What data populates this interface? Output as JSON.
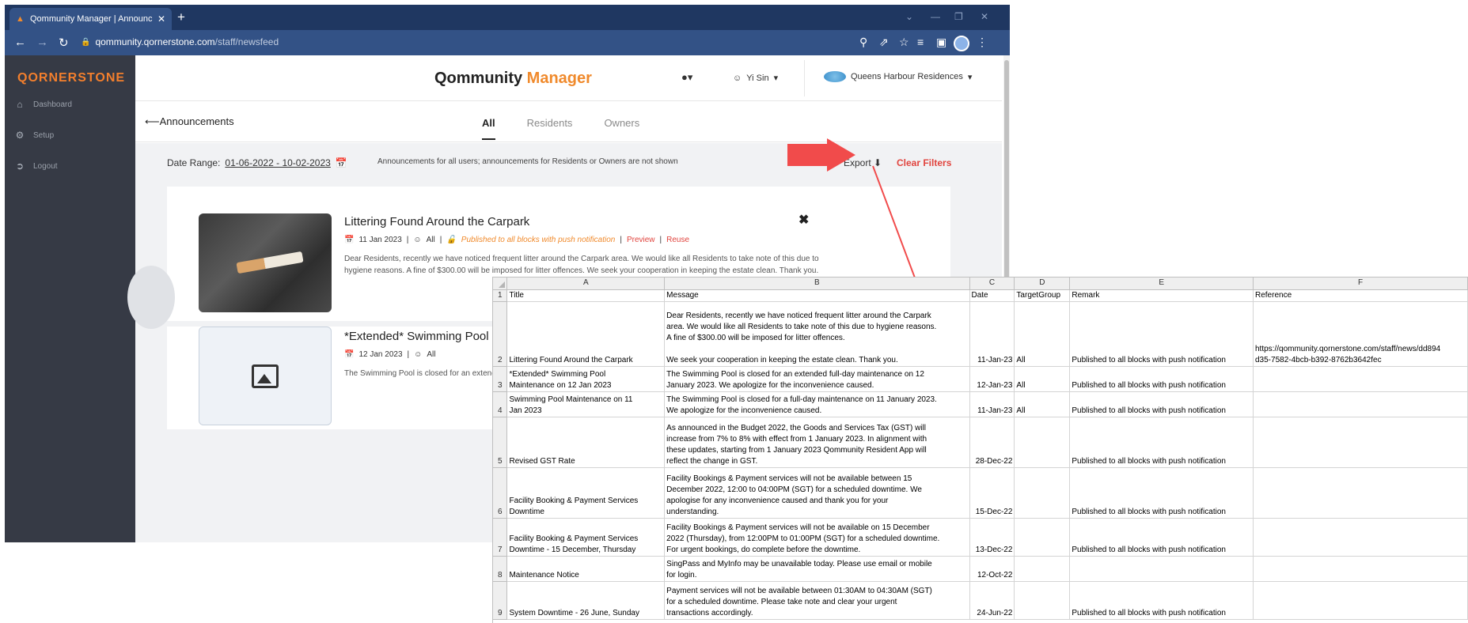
{
  "browser": {
    "tab_title": "Qommunity Manager | Announce",
    "url_host": "qommunity.qornerstone.com",
    "url_path": "/staff/newsfeed"
  },
  "sidebar": {
    "logo": "QORNERSTONE",
    "items": [
      {
        "label": "Dashboard",
        "icon": "home-icon"
      },
      {
        "label": "Setup",
        "icon": "gear-icon"
      },
      {
        "label": "Logout",
        "icon": "logout-icon"
      }
    ]
  },
  "header": {
    "brand_main": "Qommunity ",
    "brand_accent": "Manager",
    "user": "Yi Sin",
    "property": "Queens Harbour Residences"
  },
  "subheader": {
    "back_label": "Announcements",
    "tabs": [
      {
        "label": "All",
        "active": true
      },
      {
        "label": "Residents",
        "active": false
      },
      {
        "label": "Owners",
        "active": false
      }
    ]
  },
  "filters": {
    "date_range_label": "Date Range:",
    "date_range_value": "01-06-2022  -  10-02-2023",
    "note": "Announcements for all users; announcements for Residents or Owners are not shown",
    "export_label": "Export",
    "clear_label": "Clear Filters"
  },
  "cards": [
    {
      "title": "Littering Found Around the Carpark",
      "date": "11 Jan 2023",
      "audience": "All",
      "status": "Published to all blocks with push notification",
      "preview": "Preview",
      "reuse": "Reuse",
      "body": "Dear Residents, recently we have noticed frequent litter around the Carpark area. We would like all Residents to take note of this due to hygiene reasons. A fine of $300.00 will be imposed for litter offences. We seek your cooperation in keeping the estate clean. Thank you."
    },
    {
      "title": "*Extended* Swimming Pool Maintenance on 12 Jan 2023",
      "date": "12 Jan 2023",
      "audience": "All",
      "body": "The Swimming Pool is closed for an extended full-day maintenance on 12 January 2023. We apologize for the inconvenience caused."
    }
  ],
  "spreadsheet": {
    "columns": [
      "A",
      "B",
      "C",
      "D",
      "E",
      "F"
    ],
    "rows": [
      {
        "n": "1",
        "cells": [
          "Title",
          "Message",
          "Date",
          "TargetGroup",
          "Remark",
          "Reference"
        ]
      },
      {
        "n": "2",
        "cells": [
          "Littering Found Around the Carpark",
          "Dear Residents, recently we have noticed frequent litter around the Carpark\narea. We would like all Residents to take note of this due to hygiene reasons.\nA fine of $300.00 will be imposed for litter offences.\n\nWe seek your cooperation in keeping the estate clean. Thank you.",
          "11-Jan-23",
          "All",
          "Published to all blocks with push notification",
          "https://qommunity.qornerstone.com/staff/news/dd894\nd35-7582-4bcb-b392-8762b3642fec"
        ]
      },
      {
        "n": "3",
        "cells": [
          "*Extended* Swimming Pool\nMaintenance on 12 Jan 2023",
          "The Swimming Pool is closed for an extended full-day maintenance on 12\nJanuary 2023. We apologize for the inconvenience caused.",
          "12-Jan-23",
          "All",
          "Published to all blocks with push notification",
          ""
        ]
      },
      {
        "n": "4",
        "cells": [
          "Swimming Pool Maintenance on 11\nJan 2023",
          "The Swimming Pool is closed for a full-day maintenance on 11 January 2023.\nWe apologize for the inconvenience caused.",
          "11-Jan-23",
          "All",
          "Published to all blocks with push notification",
          ""
        ]
      },
      {
        "n": "5",
        "cells": [
          "Revised GST Rate",
          "As announced in the Budget 2022, the Goods and Services Tax (GST) will\nincrease from 7% to 8% with effect from 1 January 2023. In alignment with\nthese updates, starting from 1 January 2023 Qommunity Resident App will\nreflect the change in GST.",
          "28-Dec-22",
          "",
          "Published to all blocks with push notification",
          ""
        ]
      },
      {
        "n": "6",
        "cells": [
          "Facility Booking & Payment Services\nDowntime",
          "Facility Bookings & Payment services will not be available between 15\nDecember 2022, 12:00 to 04:00PM (SGT) for a scheduled downtime. We\napologise for any inconvenience caused and thank you for your\nunderstanding.",
          "15-Dec-22",
          "",
          "Published to all blocks with push notification",
          ""
        ]
      },
      {
        "n": "7",
        "cells": [
          "Facility Booking & Payment Services\nDowntime - 15 December, Thursday",
          "Facility Bookings & Payment services will not be available on 15 December\n2022 (Thursday), from 12:00PM to 01:00PM (SGT) for a scheduled downtime.\nFor urgent bookings, do complete before the downtime.",
          "13-Dec-22",
          "",
          "Published to all blocks with push notification",
          ""
        ]
      },
      {
        "n": "8",
        "cells": [
          "Maintenance Notice",
          "SingPass and MyInfo may be unavailable today. Please use email or mobile\nfor login.",
          "12-Oct-22",
          "",
          "",
          ""
        ]
      },
      {
        "n": "9",
        "cells": [
          "System Downtime - 26 June, Sunday",
          "Payment services will not be available between 01:30AM to 04:30AM (SGT)\nfor a scheduled downtime. Please take note and clear your urgent\ntransactions accordingly.",
          "24-Jun-22",
          "",
          "Published to all blocks with push notification",
          ""
        ]
      }
    ]
  }
}
